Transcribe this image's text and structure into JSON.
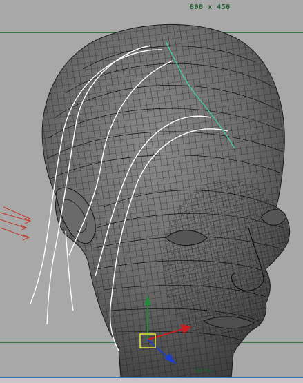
{
  "viewport": {
    "resolution_gate_label": "800 x 450",
    "camera_label": "persp",
    "background_color": "#a8a8a8",
    "gate_line_color": "#1e5a2a",
    "curve_color": "#ffffff",
    "selected_curve_color": "#3fd39a",
    "mesh_fill": "#6f6f6f",
    "wire_color": "#111111"
  },
  "manipulator": {
    "x_axis_color": "#c81e1e",
    "y_axis_color": "#1f8a3a",
    "z_axis_color": "#1e3ec8",
    "handle_color": "#e8e43a",
    "icon": "move-manipulator-icon"
  }
}
